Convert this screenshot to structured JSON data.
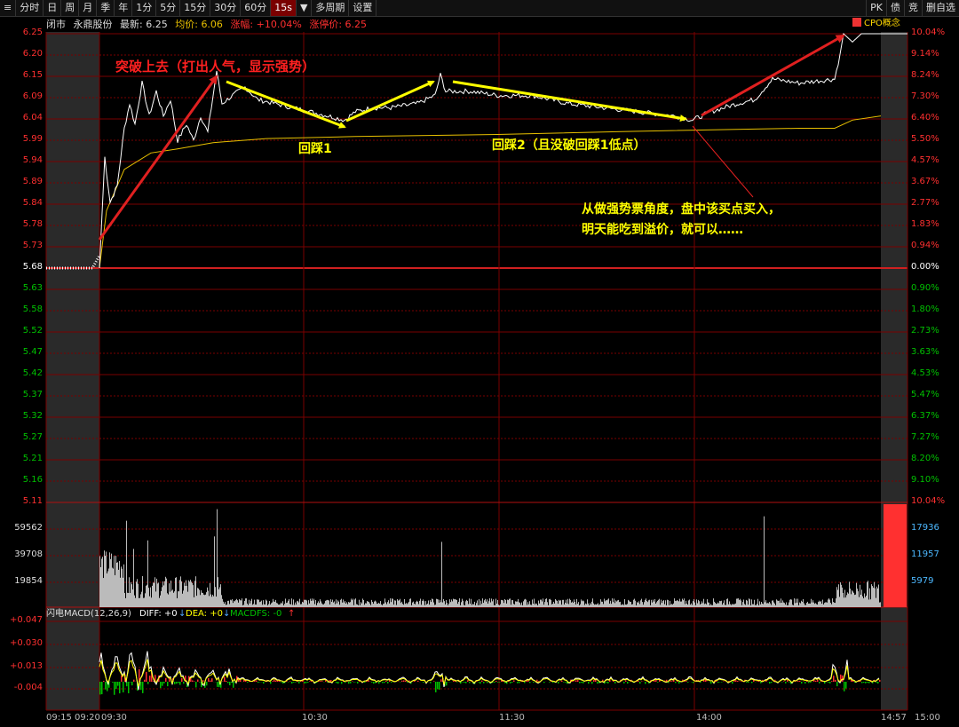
{
  "toolbar": {
    "menu_icon": "≡",
    "intervals": [
      "分时",
      "日",
      "周",
      "月",
      "季",
      "年",
      "1分",
      "5分",
      "15分",
      "30分",
      "60分",
      "15s"
    ],
    "active_interval": "15s",
    "dropdown_icon": "▼",
    "multi_period": "多周期",
    "settings": "设置",
    "right_buttons": [
      "PK",
      "债",
      "竞",
      "删自选"
    ]
  },
  "infobar": {
    "status": "闭市",
    "stock_name": "永鼎股份",
    "latest_label": "最新:",
    "latest_value": "6.25",
    "avg_label": "均价:",
    "avg_value": "6.06",
    "change_label": "涨幅:",
    "change_value": "+10.04%",
    "limit_label": "涨停价:",
    "limit_value": "6.25"
  },
  "concept_tag": "CPO概念",
  "price_axis": {
    "left": [
      "6.25",
      "6.20",
      "6.15",
      "6.09",
      "6.04",
      "5.99",
      "5.94",
      "5.89",
      "5.84",
      "5.78",
      "5.73",
      "5.68",
      "5.63",
      "5.58",
      "5.52",
      "5.47",
      "5.42",
      "5.37",
      "5.32",
      "5.27",
      "5.21",
      "5.16",
      "5.11"
    ],
    "right": [
      "10.04%",
      "9.14%",
      "8.24%",
      "7.30%",
      "6.40%",
      "5.50%",
      "4.57%",
      "3.67%",
      "2.77%",
      "1.83%",
      "0.94%",
      "0.00%",
      "0.90%",
      "1.80%",
      "2.73%",
      "3.63%",
      "4.53%",
      "5.47%",
      "6.37%",
      "7.27%",
      "8.20%",
      "9.10%",
      "10.04%"
    ],
    "prev_close": "5.68"
  },
  "volume_axis": {
    "left": [
      "59562",
      "39708",
      "19854"
    ],
    "right": [
      "17936",
      "11957",
      "5979"
    ]
  },
  "macd": {
    "title": "闪电MACD(12,26,9)",
    "diff_label": "DIFF: +0",
    "dea_label": "DEA: +0",
    "macdfs_label": "MACDFS: -0",
    "down_arrow": "↓",
    "up_arrow": "↑",
    "axis": [
      "+0.047",
      "+0.030",
      "+0.013",
      "-0.004"
    ]
  },
  "time_axis": [
    "09:15",
    "09:20",
    "09:30",
    "10:30",
    "11:30",
    "14:00",
    "14:57",
    "15:00"
  ],
  "annotations": {
    "breakout": "突破上去（打出人气，显示强势）",
    "pullback1": "回踩1",
    "pullback2": "回踩2（且没破回踩1低点）",
    "note_line1": "从做强势票角度，盘中该买点买入，",
    "note_line2": "明天能吃到溢价，就可以……"
  },
  "colors": {
    "up": "#ff3030",
    "down": "#00c000",
    "price_line": "#ffffff",
    "avg_line": "#e8c000",
    "arrow_yellow": "#ffff00",
    "arrow_red": "#e02020",
    "grid": "#7a0000"
  }
}
